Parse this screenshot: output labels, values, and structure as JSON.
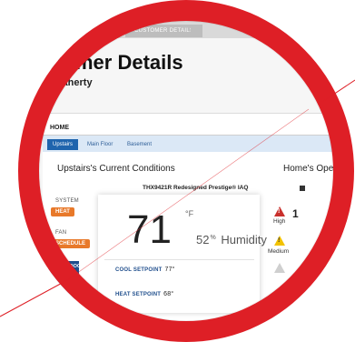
{
  "breadcrumb": {
    "current": "CUSTOMER DETAILS"
  },
  "page": {
    "title": "stomer Details",
    "customer_name": "n Flaherty"
  },
  "tabs": {
    "home": "HOME"
  },
  "zones": [
    {
      "label": "Upstairs",
      "active": true
    },
    {
      "label": "Main Floor",
      "active": false
    },
    {
      "label": "Basement",
      "active": false
    }
  ],
  "conditions": {
    "title": "Upstairs's Current Conditions",
    "device_model": "THX9421R Redesigned Prestige® IAQ",
    "system_label": "SYSTEM",
    "system_mode": "HEAT",
    "fan_label": "FAN",
    "fan_mode": "SCHEDULE",
    "outdoor_label": "OUTDOOR",
    "temperature": "71",
    "temperature_unit": "°F",
    "humidity_value": "52",
    "humidity_unit": "%",
    "humidity_label": "Humidity",
    "cool_setpoint_label": "COOL SETPOINT",
    "cool_setpoint_value": "77°",
    "heat_setpoint_label": "HEAT SETPOINT",
    "heat_setpoint_value": "68°"
  },
  "alerts": {
    "title": "Home's Open",
    "high_label": "High",
    "high_count": "1",
    "medium_label": "Medium"
  },
  "colors": {
    "ring": "#de1f26",
    "accent_blue": "#1f64ad",
    "orange": "#e8792a",
    "high_red": "#c9302c",
    "medium_yellow": "#f2c200"
  }
}
